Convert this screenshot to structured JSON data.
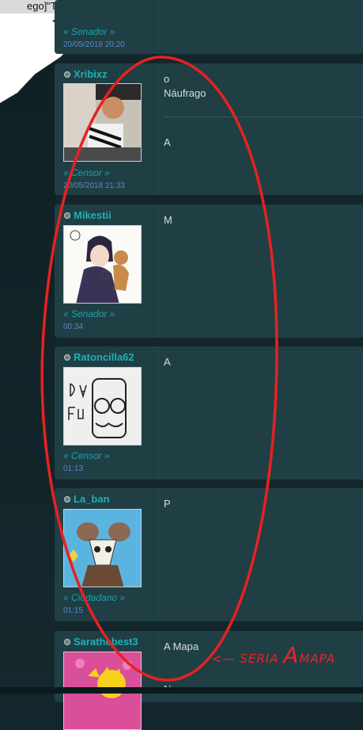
{
  "tab": {
    "title": "ego]\"Termina la palabra\""
  },
  "posts": [
    {
      "id": "p0",
      "rank": "« Senador »",
      "date": "20/05/2018 20:20"
    },
    {
      "id": "p1",
      "username": "Xribixz",
      "rank": "« Censor »",
      "date": "20/05/2018 21:33",
      "message_top": "o",
      "message_mid": "Náufrago",
      "message_bottom": "A"
    },
    {
      "id": "p2",
      "username": "Mikestii",
      "rank": "« Senador »",
      "date": "00:34",
      "message": "M"
    },
    {
      "id": "p3",
      "username": "Ratoncilla62",
      "rank": "« Censor »",
      "date": "01:13",
      "message": "A"
    },
    {
      "id": "p4",
      "username": "La_ban",
      "rank": "« Ciudadano »",
      "date": "01:15",
      "message": "P"
    },
    {
      "id": "p5",
      "username": "Sarathebest3",
      "message": "A Mapa",
      "message_next": "N"
    }
  ],
  "annotation": {
    "arrow": "<—",
    "word": "SERIA",
    "big": "A",
    "tail": "MAPA",
    "color": "#e62020"
  },
  "colors": {
    "username": "#1fb0b8",
    "rank": "#1fa2ac",
    "date": "#5f86c9",
    "panel": "#1f3f45",
    "page": "#12262b"
  }
}
